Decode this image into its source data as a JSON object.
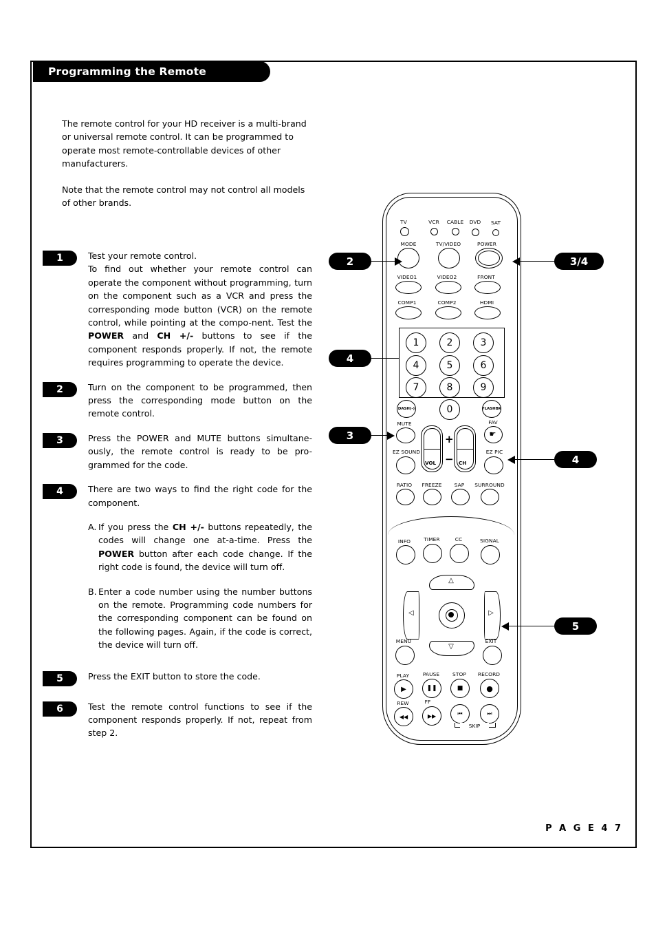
{
  "header": {
    "title": "Programming the Remote"
  },
  "intro": {
    "p1": "The remote control for your HD receiver is a multi-brand or universal remote control. It can be programmed to operate most remote-controllable devices of other manufacturers.",
    "p2": "Note that the remote control may not control all models of other brands."
  },
  "steps": [
    {
      "num": "1",
      "line1": "Test your remote control.",
      "text": "To find out whether your remote control can operate the component without programming, turn on the component such as a VCR and press the corresponding mode button (VCR) on the remote control, while pointing at the compo-nent. Test the POWER and CH +/- buttons to see if the component responds properly. If not, the remote requires programming to operate the device."
    },
    {
      "num": "2",
      "text": "Turn on the component to be programmed, then press the corresponding mode button on the remote control."
    },
    {
      "num": "3",
      "text": "Press the POWER and MUTE buttons simultane-ously, the remote control is ready to be pro-grammed for the code."
    },
    {
      "num": "4",
      "text": "There are two ways to find the right code for the component."
    },
    {
      "num": "5",
      "text": "Press the EXIT button to store the code."
    },
    {
      "num": "6",
      "text": "Test the remote control functions to see if the component responds properly. If not, repeat from step 2."
    }
  ],
  "substeps": [
    {
      "letter": "A.",
      "text": "If you press the CH +/- buttons repeatedly, the codes will change one at-a-time. Press the POWER button after each code change. If the right code is found, the device will turn off."
    },
    {
      "letter": "B.",
      "text": "Enter a code number using the number buttons on the remote. Programming code numbers for the corresponding component can be found on the following pages. Again, if the code is correct, the device will turn off."
    }
  ],
  "bold_terms": [
    "POWER",
    "CH +/-"
  ],
  "remote": {
    "indicators": [
      {
        "label": "TV"
      },
      {
        "label": "VCR"
      },
      {
        "label": "CABLE"
      },
      {
        "label": "DVD"
      },
      {
        "label": "SAT"
      }
    ],
    "row_mode": [
      {
        "label": "MODE"
      },
      {
        "label": "TV/VIDEO"
      },
      {
        "label": "POWER"
      }
    ],
    "row_video": [
      {
        "label": "VIDEO1"
      },
      {
        "label": "VIDEO2"
      },
      {
        "label": "FRONT"
      }
    ],
    "row_comp": [
      {
        "label": "COMP1"
      },
      {
        "label": "COMP2"
      },
      {
        "label": "HDMI"
      }
    ],
    "keypad": [
      "1",
      "2",
      "3",
      "4",
      "5",
      "6",
      "7",
      "8",
      "9"
    ],
    "zero": "0",
    "dash": "DASH(-)",
    "flashbk": "FLASHBK",
    "row_mute": [
      {
        "label": "MUTE"
      },
      {
        "label": "FAV"
      }
    ],
    "row_ez": [
      {
        "label": "EZ SOUND"
      },
      {
        "label": "EZ PIC"
      }
    ],
    "rockers": {
      "vol": "VOL",
      "ch": "CH",
      "plus": "+",
      "minus": "−"
    },
    "row_ratio": [
      {
        "label": "RATIO"
      },
      {
        "label": "FREEZE"
      },
      {
        "label": "SAP"
      },
      {
        "label": "SURROUND"
      }
    ],
    "row_info": [
      {
        "label": "INFO"
      },
      {
        "label": "TIMER"
      },
      {
        "label": "CC"
      },
      {
        "label": "SIGNAL"
      }
    ],
    "row_menu": [
      {
        "label": "MENU"
      },
      {
        "label": "EXIT"
      }
    ],
    "row_play": [
      {
        "label": "PLAY"
      },
      {
        "label": "PAUSE"
      },
      {
        "label": "STOP"
      },
      {
        "label": "RECORD"
      }
    ],
    "row_rew": [
      {
        "label": "REW"
      },
      {
        "label": "FF"
      }
    ],
    "skip": "SKIP"
  },
  "callouts": [
    {
      "id": "co2",
      "label": "2"
    },
    {
      "id": "co34",
      "label": "3/4"
    },
    {
      "id": "co4l",
      "label": "4"
    },
    {
      "id": "co4r",
      "label": "4"
    },
    {
      "id": "co3",
      "label": "3"
    },
    {
      "id": "co5",
      "label": "5"
    }
  ],
  "footer": {
    "page": "P A G E   4 7"
  }
}
